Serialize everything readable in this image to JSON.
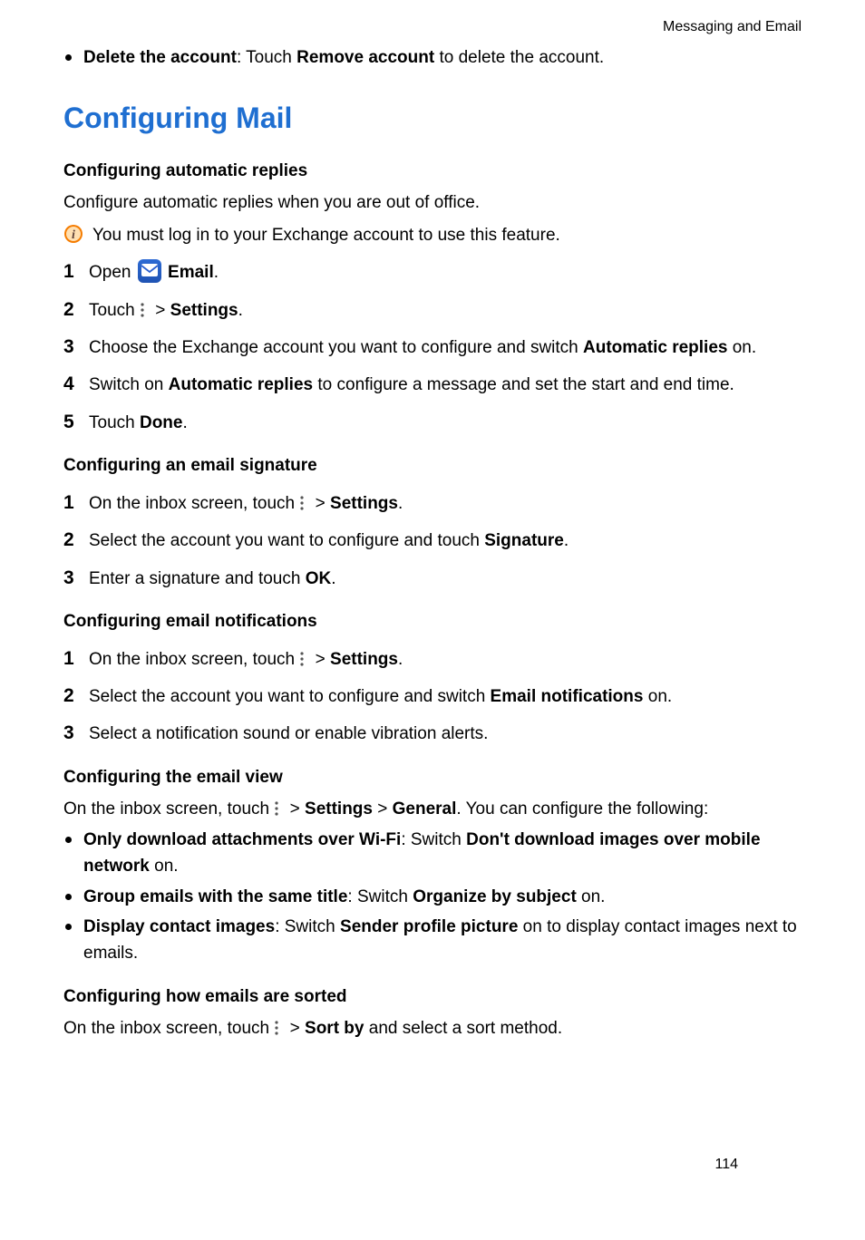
{
  "header": {
    "section": "Messaging and Email"
  },
  "intro_bullet": {
    "lead_bold": "Delete the account",
    "text_before": ": Touch ",
    "remove_bold": "Remove account",
    "text_after": " to delete the account."
  },
  "title": "Configuring Mail",
  "auto": {
    "heading": "Configuring automatic replies",
    "sub": "Configure automatic replies when you are out of office.",
    "info": "You must log in to your Exchange account to use this feature.",
    "steps": {
      "s1_a": "Open ",
      "s1_b": "Email",
      "s1_c": ".",
      "s2_a": "Touch ",
      "s2_b": " > ",
      "s2_c": "Settings",
      "s2_d": ".",
      "s3_a": "Choose the Exchange account you want to configure and switch ",
      "s3_b": "Automatic replies",
      "s3_c": " on.",
      "s4_a": "Switch on ",
      "s4_b": "Automatic replies",
      "s4_c": " to configure a message and set the start and end time.",
      "s5_a": "Touch ",
      "s5_b": "Done",
      "s5_c": "."
    }
  },
  "sig": {
    "heading": "Configuring an email signature",
    "s1_a": "On the inbox screen, touch ",
    "s1_b": " > ",
    "s1_c": "Settings",
    "s1_d": ".",
    "s2_a": "Select the account you want to configure and touch ",
    "s2_b": "Signature",
    "s2_c": ".",
    "s3_a": "Enter a signature and touch ",
    "s3_b": "OK",
    "s3_c": "."
  },
  "notif": {
    "heading": "Configuring email notifications",
    "s1_a": "On the inbox screen, touch ",
    "s1_b": " > ",
    "s1_c": "Settings",
    "s1_d": ".",
    "s2_a": "Select the account you want to configure and switch ",
    "s2_b": "Email notifications",
    "s2_c": " on.",
    "s3": "Select a notification sound or enable vibration alerts."
  },
  "view": {
    "heading": "Configuring the email view",
    "intro_a": "On the inbox screen, touch ",
    "intro_b": " > ",
    "intro_c": "Settings",
    "intro_d": " > ",
    "intro_e": "General",
    "intro_f": ". You can configure the following:",
    "b1_a": "Only download attachments over Wi-Fi",
    "b1_b": ": Switch ",
    "b1_c": "Don't download images over mobile network",
    "b1_d": " on.",
    "b2_a": "Group emails with the same title",
    "b2_b": ": Switch ",
    "b2_c": "Organize by subject",
    "b2_d": " on.",
    "b3_a": "Display contact images",
    "b3_b": ": Switch ",
    "b3_c": "Sender profile picture",
    "b3_d": " on to display contact images next to emails."
  },
  "sort": {
    "heading": "Configuring how emails are sorted",
    "a": "On the inbox screen, touch ",
    "b": " > ",
    "c": "Sort by",
    "d": " and select a sort method."
  },
  "page_number": "114"
}
